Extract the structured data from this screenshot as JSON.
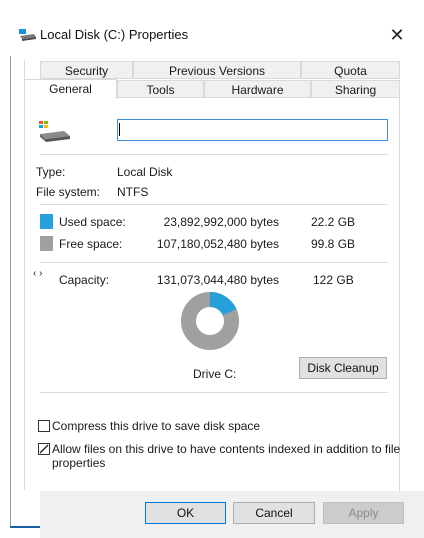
{
  "window": {
    "title": "Local Disk (C:) Properties",
    "close_glyph": "✕"
  },
  "tabs": {
    "row1": [
      {
        "label": "Security"
      },
      {
        "label": "Previous Versions"
      },
      {
        "label": "Quota"
      }
    ],
    "row2": [
      {
        "label": "General",
        "active": true
      },
      {
        "label": "Tools"
      },
      {
        "label": "Hardware"
      },
      {
        "label": "Sharing"
      }
    ]
  },
  "general": {
    "drive_name_value": "",
    "type_label": "Type:",
    "type_value": "Local Disk",
    "fs_label": "File system:",
    "fs_value": "NTFS",
    "used": {
      "label": "Used space:",
      "bytes": "23,892,992,000 bytes",
      "size": "22.2 GB",
      "color": "#26a0da"
    },
    "free": {
      "label": "Free space:",
      "bytes": "107,180,052,480 bytes",
      "size": "99.8 GB",
      "color": "#a0a0a0"
    },
    "capacity": {
      "label": "Capacity:",
      "bytes": "131,073,044,480 bytes",
      "size": "122 GB"
    },
    "used_fraction": 0.182,
    "drive_label": "Drive C:",
    "cleanup_button": "Disk Cleanup",
    "compress_label": "Compress this drive to save disk space",
    "index_label_1": "Allow files on this drive to have contents indexed in addition to file",
    "index_label_2": "properties",
    "compress_checked": false,
    "index_checked": true
  },
  "footer": {
    "ok": "OK",
    "cancel": "Cancel",
    "apply": "Apply"
  }
}
